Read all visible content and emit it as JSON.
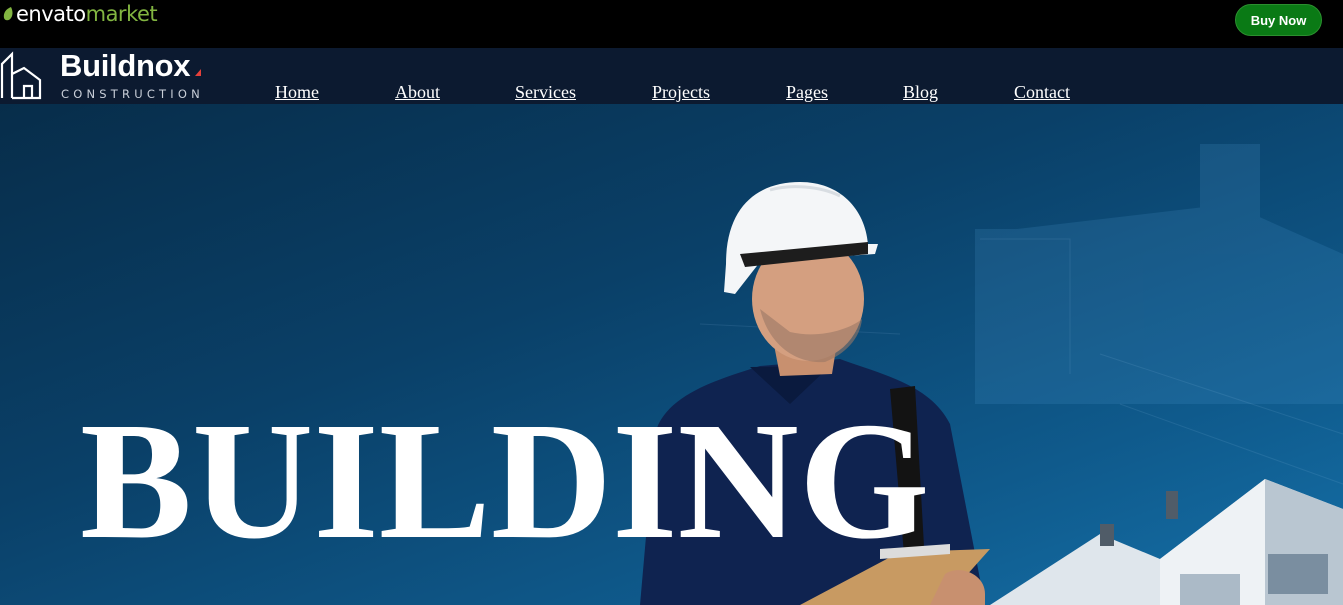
{
  "envato": {
    "logo_text_1": "envato",
    "logo_text_2": "market",
    "buy_now_label": "Buy Now"
  },
  "site": {
    "brand_name": "Buildnox",
    "brand_tagline": "CONSTRUCTION"
  },
  "nav": {
    "items": [
      "Home",
      "About",
      "Services",
      "Projects",
      "Pages",
      "Blog",
      "Contact"
    ]
  },
  "hero": {
    "title": "BUILDING"
  },
  "colors": {
    "envato_green": "#82b541",
    "buy_now_bg": "#0a7a15",
    "nav_bg": "#0c1a30",
    "hero_blue": "#0a4068",
    "brand_accent": "#e5403a"
  }
}
